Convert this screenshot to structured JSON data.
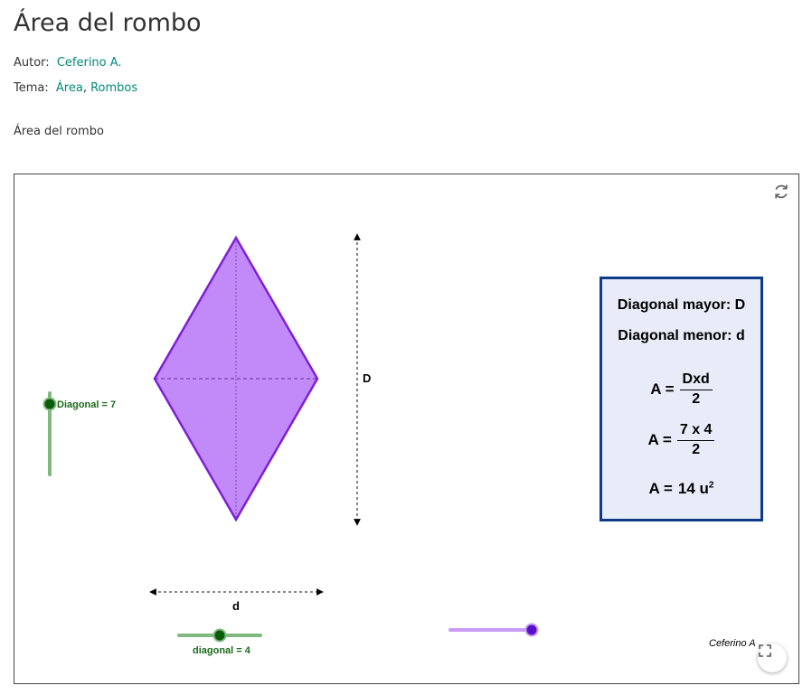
{
  "page": {
    "title": "Área del rombo",
    "author_label": "Autor:",
    "author_name": "Ceferino A.",
    "topic_label": "Tema:",
    "topics": [
      "Área",
      "Rombos"
    ],
    "description": "Área del rombo"
  },
  "applet": {
    "labels": {
      "major_diagonal": "D",
      "minor_diagonal": "d",
      "slider_major": "Diagonal = 7",
      "slider_minor": "diagonal = 4"
    },
    "sliders": {
      "major": {
        "value": 7,
        "level": 0.15
      },
      "minor": {
        "value": 4,
        "level": 0.5
      },
      "color": {
        "level": 1.0
      }
    },
    "info_box": {
      "line1": "Diagonal mayor: D",
      "line2": "Diagonal menor: d",
      "formula1_lhs": "A",
      "formula1_num": "Dxd",
      "formula1_den": "2",
      "formula2_lhs": "A",
      "formula2_num": "7 x 4",
      "formula2_den": "2",
      "result_lhs": "A",
      "result_value": "14 u",
      "result_exp": "2"
    },
    "credit": "Ceferino A",
    "icons": {
      "reset": "refresh-icon",
      "fullscreen": "fullscreen-icon"
    },
    "colors": {
      "rhombus_fill": "#c18af8",
      "rhombus_stroke": "#7e1fd6",
      "slider_green": "#7fb97f",
      "slider_knob": "#0a5c0a",
      "slider_text": "#1b6b1b",
      "slider_purple": "#c89bf5",
      "knob_purple": "#5a0fc7",
      "box_border": "#0d3b8a",
      "box_fill": "#e8ecf8",
      "link": "#00897b"
    }
  }
}
